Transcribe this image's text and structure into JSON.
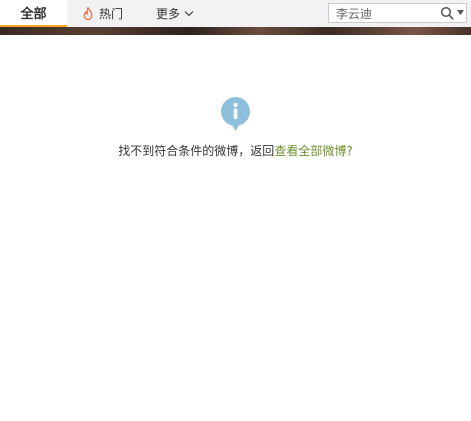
{
  "nav": {
    "tabs": [
      {
        "label": "全部",
        "active": true
      },
      {
        "label": "热门",
        "icon": "fire-icon"
      },
      {
        "label": "更多",
        "icon": "chevron-down-icon"
      }
    ],
    "accent_color": "#f5a623"
  },
  "search": {
    "value": "李云迪",
    "icon": "search-icon",
    "dropdown_icon": "caret-down-icon"
  },
  "empty_state": {
    "icon": "info-icon",
    "icon_color": "#8ebfdc",
    "message": "找不到符合条件的微博，返回",
    "link_text": "查看全部微博?",
    "link_color": "#6b8f2b"
  }
}
